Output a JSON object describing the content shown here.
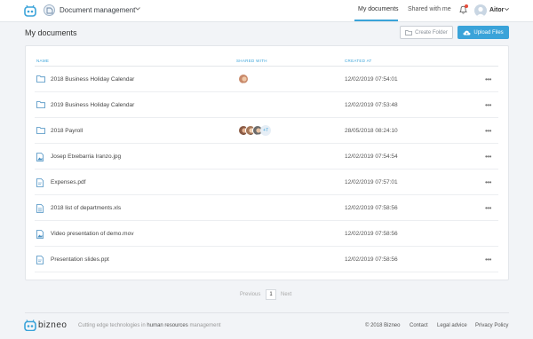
{
  "header": {
    "module": "Document management",
    "tabs": [
      {
        "label": "My documents"
      },
      {
        "label": "Shared with me"
      }
    ],
    "user": "Aitor"
  },
  "page": {
    "title": "My documents",
    "create_folder": "Create Folder",
    "upload": "Upload Files"
  },
  "table": {
    "columns": [
      "NAME",
      "SHARED WITH",
      "CREATED AT"
    ],
    "rows": [
      {
        "name": "2018 Business Holiday Calendar",
        "date": "12/02/2019 07:54:01",
        "type": "folder"
      },
      {
        "name": "2019 Business Holiday Calendar",
        "date": "12/02/2019 07:53:48",
        "type": "folder"
      },
      {
        "name": "2018 Payroll",
        "date": "28/05/2018 08:24:10",
        "type": "folder",
        "shared_more": "+7"
      },
      {
        "name": "Josep Etxebarria Iranzo.jpg",
        "date": "12/02/2019 07:54:54",
        "type": "image"
      },
      {
        "name": "Expenses.pdf",
        "date": "12/02/2019 07:57:01",
        "type": "file"
      },
      {
        "name": "2018 list of departments.xls",
        "date": "12/02/2019 07:58:56",
        "type": "file"
      },
      {
        "name": "Video presentation of demo.mov",
        "date": "12/02/2019 07:58:56",
        "type": "image"
      },
      {
        "name": "Presentation slides.ppt",
        "date": "12/02/2019 07:58:56",
        "type": "file"
      }
    ],
    "more": "•••"
  },
  "pager": {
    "prev": "Previous",
    "page": "1",
    "next": "Next"
  },
  "footer": {
    "brand": "bizneo",
    "tag_pre": "Cutting edge technologies in",
    "tag_bold": "human resources",
    "tag_post": "management",
    "copyright": "© 2018 Bizneo",
    "contact": "Contact",
    "legal": "Legal advice",
    "privacy": "Privacy Policy"
  },
  "colors": {
    "accent": "#3aa3d9",
    "notification": "#e74c3c"
  }
}
